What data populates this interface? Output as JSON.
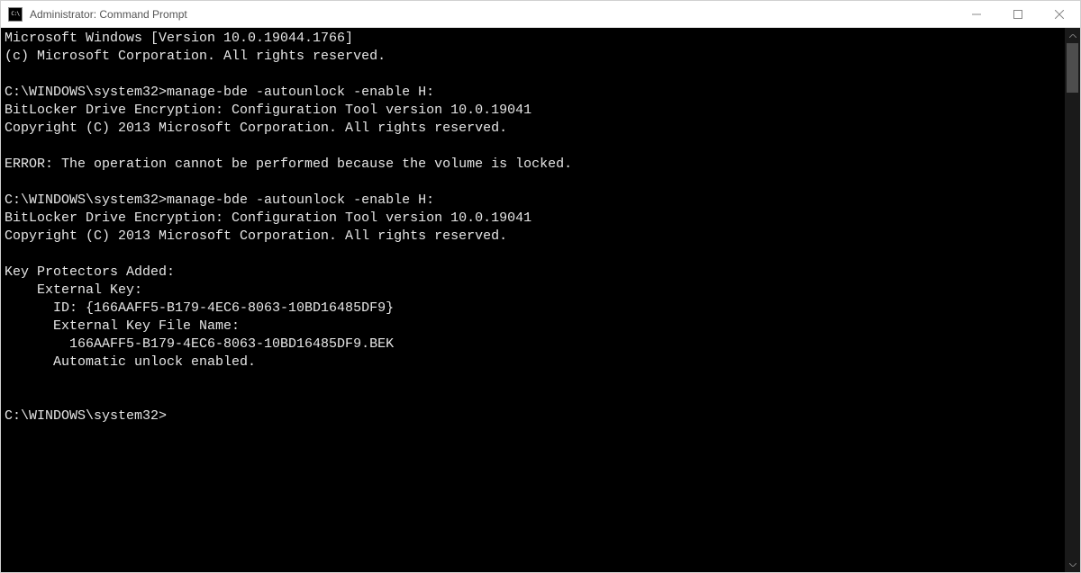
{
  "window": {
    "title": "Administrator: Command Prompt"
  },
  "terminal": {
    "lines": [
      "Microsoft Windows [Version 10.0.19044.1766]",
      "(c) Microsoft Corporation. All rights reserved.",
      "",
      "C:\\WINDOWS\\system32>manage-bde -autounlock -enable H:",
      "BitLocker Drive Encryption: Configuration Tool version 10.0.19041",
      "Copyright (C) 2013 Microsoft Corporation. All rights reserved.",
      "",
      "ERROR: The operation cannot be performed because the volume is locked.",
      "",
      "C:\\WINDOWS\\system32>manage-bde -autounlock -enable H:",
      "BitLocker Drive Encryption: Configuration Tool version 10.0.19041",
      "Copyright (C) 2013 Microsoft Corporation. All rights reserved.",
      "",
      "Key Protectors Added:",
      "    External Key:",
      "      ID: {166AAFF5-B179-4EC6-8063-10BD16485DF9}",
      "      External Key File Name:",
      "        166AAFF5-B179-4EC6-8063-10BD16485DF9.BEK",
      "      Automatic unlock enabled.",
      "",
      "",
      "C:\\WINDOWS\\system32>"
    ]
  }
}
